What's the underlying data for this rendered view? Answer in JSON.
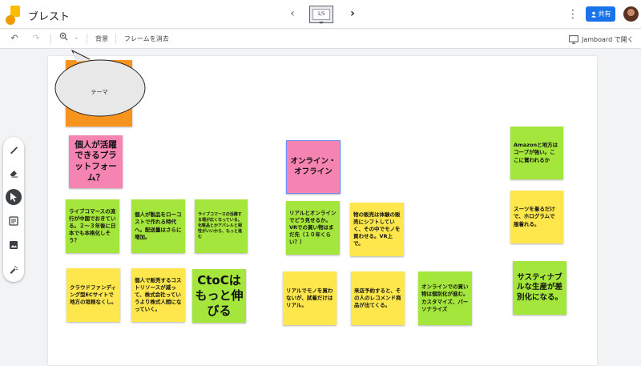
{
  "header": {
    "title": "ブレスト",
    "frame_counter": "1/5",
    "share_label": "共有",
    "icons": {
      "prev": "chevron-left-icon",
      "next": "chevron-right-icon",
      "more": "more-vert-icon",
      "share": "person-add-icon"
    }
  },
  "toolbar": {
    "zoom_dropdown": "-",
    "background_label": "背景",
    "clear_frame_label": "フレームを消去",
    "open_jamboard_label": "Jamboard で開く"
  },
  "palette": {
    "tools": [
      "pen",
      "eraser",
      "select",
      "sticky-note",
      "image",
      "laser"
    ],
    "active": "select"
  },
  "canvas": {
    "speech_bubble_text": "テーマ",
    "notes": [
      {
        "id": "n1",
        "color": "pink",
        "text": "個人が活躍できるプラットフォーム？"
      },
      {
        "id": "n2",
        "color": "pink",
        "text": "オンライン・オフライン"
      },
      {
        "id": "n3",
        "color": "green",
        "text": "Amazonと地方はコープが強い。ここに賞われるか"
      },
      {
        "id": "n4",
        "color": "green",
        "text": "ライブコマースの流行が中国でおきている。２〜３年後に日本でも本格化しそう？"
      },
      {
        "id": "n5",
        "color": "green",
        "text": "個人が製品をローコストで作れる時代へ。配送量はさらに増加。"
      },
      {
        "id": "n6",
        "color": "green",
        "text": "ライブコマースの活躍する場が広くなっている。化粧品とかアパレルと相性がいいから、もっと進む"
      },
      {
        "id": "n7",
        "color": "green",
        "text": "リアルとオンラインでどう見せるか。VRでの買い物はまだ先（１０年くらい？）"
      },
      {
        "id": "n8",
        "color": "yellow",
        "text": "物の販売は体験の販売にシフトしていく、その中でモノを買わせる。VR上で。"
      },
      {
        "id": "n9",
        "color": "yellow",
        "text": "スーツを着るだけで、ホログラムで服着れる。"
      },
      {
        "id": "n10",
        "color": "yellow",
        "text": "クラウドファンディング型ECサイトで地方の垣根なくし。"
      },
      {
        "id": "n11",
        "color": "yellow",
        "text": "個人で販売するコストリソースが減って、株式会社っていうより株式人間になっていく。"
      },
      {
        "id": "n12",
        "color": "green",
        "text": "CtoCはもっと伸びる"
      },
      {
        "id": "n13",
        "color": "yellow",
        "text": "リアルでモノを買わないが、試着だけはリアル。"
      },
      {
        "id": "n14",
        "color": "yellow",
        "text": "来店予約すると、その人のレコメンド商品が出てくる。"
      },
      {
        "id": "n15",
        "color": "green",
        "text": "オンラインでの買い物は個別化が進む。カスタマイズ、パーソナライズ"
      },
      {
        "id": "n16",
        "color": "green",
        "text": "サスティナブルな生産が差別化になる。"
      }
    ]
  }
}
